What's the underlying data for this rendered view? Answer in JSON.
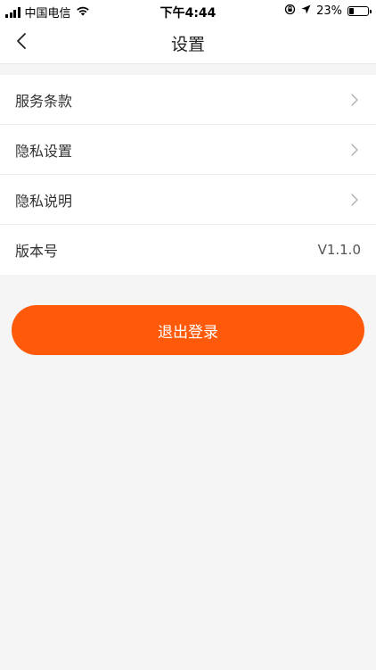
{
  "status_bar": {
    "carrier": "中国电信",
    "time": "下午4:44",
    "battery_text": "23%",
    "battery_level": 0.23,
    "icons": [
      "signal-icon",
      "wifi-icon",
      "orientation-lock-icon",
      "location-icon",
      "battery-icon"
    ]
  },
  "nav": {
    "title": "设置",
    "back_icon": "chevron-left-icon"
  },
  "settings": {
    "items": [
      {
        "label": "服务条款",
        "icon": "chevron-right-icon"
      },
      {
        "label": "隐私设置",
        "icon": "chevron-right-icon"
      },
      {
        "label": "隐私说明",
        "icon": "chevron-right-icon"
      }
    ],
    "version": {
      "label": "版本号",
      "value": "V1.1.0"
    }
  },
  "logout": {
    "label": "退出登录",
    "color": "#ff5a0a"
  },
  "colors": {
    "background": "#f5f5f5",
    "surface": "#ffffff",
    "accent": "#ff5a0a"
  }
}
